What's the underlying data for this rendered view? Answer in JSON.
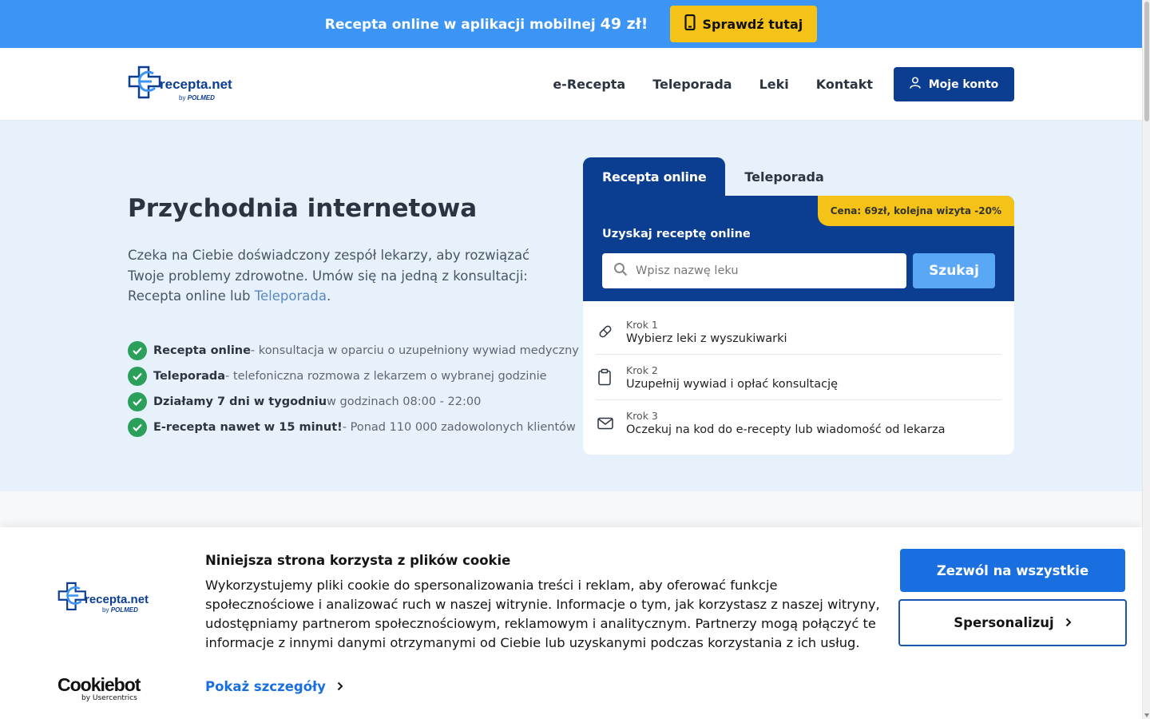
{
  "promo": {
    "text": "Recepta online w aplikacji mobilnej",
    "price": "49 zł!",
    "button_label": "Sprawdź tutaj"
  },
  "brand": {
    "logo_text": "recepta.net",
    "logo_by": "by",
    "logo_sub": "POLMED",
    "primary_color": "#0b3d91",
    "accent_color": "#f5c218"
  },
  "nav": {
    "items": [
      "e-Recepta",
      "Teleporada",
      "Leki",
      "Kontakt"
    ],
    "account_label": "Moje konto"
  },
  "hero": {
    "title": "Przychodnia internetowa",
    "desc_before": "Czeka na Ciebie doświadczony zespół lekarzy, aby rozwiązać Twoje problemy zdrowotne. Umów się na jedną z konsultacji: Recepta online lub ",
    "desc_link": "Teleporada",
    "desc_after": ".",
    "features": [
      {
        "bold": "Recepta online",
        "rest": " - konsultacja w oparciu o uzupełniony wywiad medyczny"
      },
      {
        "bold": "Teleporada",
        "rest": " - telefoniczna rozmowa z lekarzem o wybranej godzinie"
      },
      {
        "bold": "Działamy 7 dni w tygodniu",
        "rest": " w godzinach 08:00 - 22:00"
      },
      {
        "bold": "E-recepta nawet w 15 minut!",
        "rest": " - Ponad 110 000 zadowolonych klientów"
      }
    ]
  },
  "card": {
    "tabs": [
      "Recepta online",
      "Teleporada"
    ],
    "badge": "Cena: 69zł, kolejna wizyta -20%",
    "label": "Uzyskaj receptę online",
    "search_placeholder": "Wpisz nazwę leku",
    "search_button": "Szukaj",
    "steps": [
      {
        "num": "Krok 1",
        "text": "Wybierz leki z wyszukiwarki",
        "icon": "pill-icon"
      },
      {
        "num": "Krok 2",
        "text": "Uzupełnij wywiad i opłać konsultację",
        "icon": "clipboard-icon"
      },
      {
        "num": "Krok 3",
        "text": "Oczekuj na kod do e-recepty lub wiadomość od lekarza",
        "icon": "mail-icon"
      }
    ]
  },
  "cookie": {
    "title": "Niniejsza strona korzysta z plików cookie",
    "text": "Wykorzystujemy pliki cookie do spersonalizowania treści i reklam, aby oferować funkcje społecznościowe i analizować ruch w naszej witrynie. Informacje o tym, jak korzystasz z naszej witryny, udostępniamy partnerom społecznościowym, reklamowym i analitycznym. Partnerzy mogą połączyć te informacje z innymi danymi otrzymanymi od Ciebie lub uzyskanymi podczas korzystania z ich usług.",
    "details_label": "Pokaż szczegóły",
    "allow_label": "Zezwól na wszystkie",
    "customize_label": "Spersonalizuj",
    "provider_name": "Cookiebot",
    "provider_sub": "by Usercentrics"
  }
}
